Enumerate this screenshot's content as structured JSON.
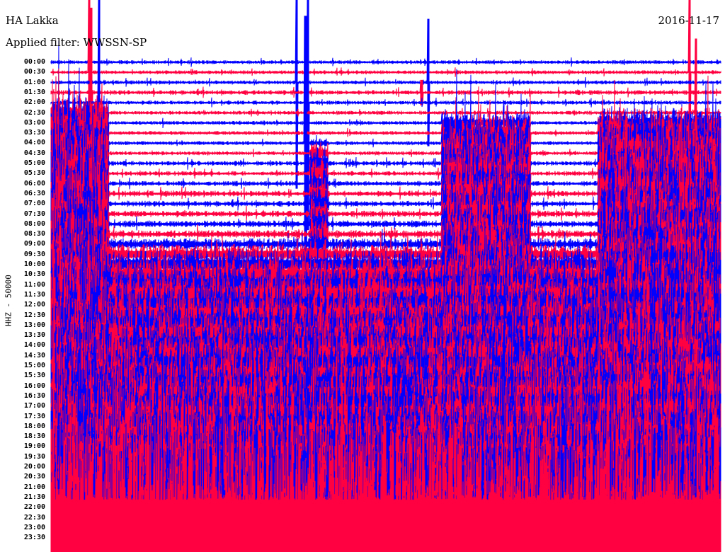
{
  "chart_data": {
    "type": "line",
    "title": "HA Lakka",
    "subtitle": "Applied filter: WWSSN-SP",
    "date": "2016-11-17",
    "ylabel": "HHZ - 50000",
    "xlabel": "",
    "row_duration_min": 30,
    "colors": [
      "#0000ff",
      "#ff0040"
    ],
    "row_labels": [
      "00:00",
      "00:30",
      "01:00",
      "01:30",
      "02:00",
      "02:30",
      "03:00",
      "03:30",
      "04:00",
      "04:30",
      "05:00",
      "05:30",
      "06:00",
      "06:30",
      "07:00",
      "07:30",
      "08:00",
      "08:30",
      "09:00",
      "09:30",
      "10:00",
      "10:30",
      "11:00",
      "11:30",
      "12:00",
      "12:30",
      "13:00",
      "13:30",
      "14:00",
      "14:30",
      "15:00",
      "15:30",
      "16:00",
      "16:30",
      "17:00",
      "17:30",
      "18:00",
      "18:30",
      "19:00",
      "19:30",
      "20:00",
      "20:30",
      "21:00",
      "21:30",
      "22:00",
      "22:30",
      "23:00",
      "23:30"
    ],
    "row_noise_amplitude": [
      1,
      1,
      1,
      1.2,
      1,
      1,
      1,
      1,
      1,
      1,
      1.2,
      1.2,
      1.3,
      1.5,
      1.5,
      1.6,
      1.8,
      2,
      3,
      5,
      7,
      8,
      9,
      10,
      10,
      11,
      11,
      12,
      12,
      12,
      13,
      13,
      14,
      14,
      15,
      15,
      16,
      16,
      17,
      17,
      18,
      18,
      20,
      22,
      30,
      40,
      50,
      60
    ],
    "hotspots": [
      {
        "start_min": 0,
        "end_min": 2.6,
        "from_row": 5,
        "amp": 20
      },
      {
        "start_min": 11.6,
        "end_min": 12.4,
        "from_row": 8,
        "amp": 8
      },
      {
        "start_min": 17.5,
        "end_min": 21.5,
        "from_row": 6,
        "amp": 14
      },
      {
        "start_min": 24.5,
        "end_min": 30,
        "from_row": 6,
        "amp": 18
      }
    ],
    "spikes": [
      {
        "row": 1,
        "minute": 1.7,
        "amp": 60
      },
      {
        "row": 3,
        "minute": 1.8,
        "amp": 40
      },
      {
        "row": 4,
        "minute": 2.15,
        "amp": 120
      },
      {
        "row": 2,
        "minute": 11.0,
        "amp": 50
      },
      {
        "row": 4,
        "minute": 11.5,
        "amp": 60
      },
      {
        "row": 8,
        "minute": 11.4,
        "amp": 60
      },
      {
        "row": 2,
        "minute": 16.9,
        "amp": 30
      },
      {
        "row": 3,
        "minute": 16.6,
        "amp": 6
      },
      {
        "row": 1,
        "minute": 28.6,
        "amp": 40
      },
      {
        "row": 5,
        "minute": 28.9,
        "amp": 35
      }
    ]
  }
}
